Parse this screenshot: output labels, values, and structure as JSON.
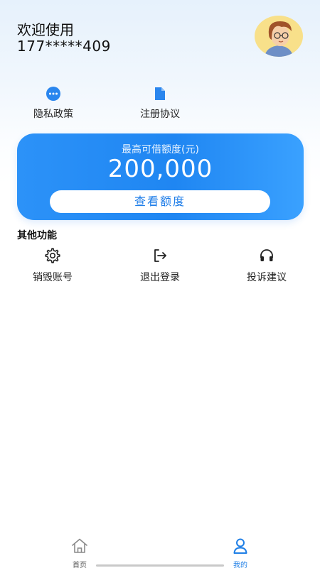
{
  "header": {
    "welcome": "欢迎使用",
    "phone": "177*****409",
    "avatar_icon": "cartoon-avatar"
  },
  "quick_links": [
    {
      "label": "隐私政策",
      "icon": "chat-bubble-icon"
    },
    {
      "label": "注册协议",
      "icon": "document-icon"
    }
  ],
  "credit_card": {
    "title": "最高可借额度(元)",
    "amount": "200,000",
    "button": "查看额度"
  },
  "other_functions": {
    "title": "其他功能",
    "items": [
      {
        "label": "销毁账号",
        "icon": "gear-icon"
      },
      {
        "label": "退出登录",
        "icon": "logout-icon"
      },
      {
        "label": "投诉建议",
        "icon": "headphones-icon"
      }
    ]
  },
  "tabbar": {
    "tabs": [
      {
        "label": "首页",
        "icon": "home-icon",
        "active": false
      },
      {
        "label": "我的",
        "icon": "user-icon",
        "active": true
      }
    ]
  },
  "colors": {
    "accent": "#1f86f2",
    "tab_active": "#1f7fe6",
    "tab_inactive": "#8a8a8a"
  }
}
